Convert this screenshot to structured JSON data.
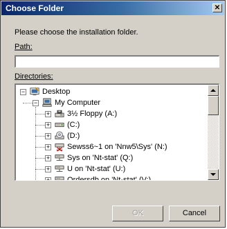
{
  "window": {
    "title": "Choose Folder",
    "close_glyph": "✕"
  },
  "prompt": "Please choose the installation folder.",
  "path": {
    "label": "Path:",
    "value": ""
  },
  "directories": {
    "label": "Directories:",
    "items": [
      {
        "label": "Desktop",
        "icon": "desktop-icon",
        "level": 0,
        "expander": "−"
      },
      {
        "label": "My Computer",
        "icon": "computer-icon",
        "level": 1,
        "expander": "−"
      },
      {
        "label": "3½ Floppy (A:)",
        "icon": "floppy-drive-icon",
        "level": 2,
        "expander": "+"
      },
      {
        "label": "(C:)",
        "icon": "hard-drive-icon",
        "level": 2,
        "expander": "+"
      },
      {
        "label": "(D:)",
        "icon": "cd-drive-icon",
        "level": 2,
        "expander": "+"
      },
      {
        "label": "Sewss6~1 on 'Nnw5\\Sys' (N:)",
        "icon": "disconnected-network-drive-icon",
        "level": 2,
        "expander": "+"
      },
      {
        "label": "Sys on 'Nt-stat' (Q:)",
        "icon": "network-drive-icon",
        "level": 2,
        "expander": "+"
      },
      {
        "label": "U on 'Nt-stat' (U:)",
        "icon": "network-drive-icon",
        "level": 2,
        "expander": "+"
      },
      {
        "label": "Ordersdb on 'Nt-stat' (V:)",
        "icon": "network-drive-icon",
        "level": 2,
        "expander": "+"
      }
    ]
  },
  "buttons": {
    "ok": "OK",
    "cancel": "Cancel"
  },
  "colors": {
    "titlebar_start": "#0a246a",
    "titlebar_end": "#a6caf0",
    "dialog_face": "#d4d0c8"
  }
}
